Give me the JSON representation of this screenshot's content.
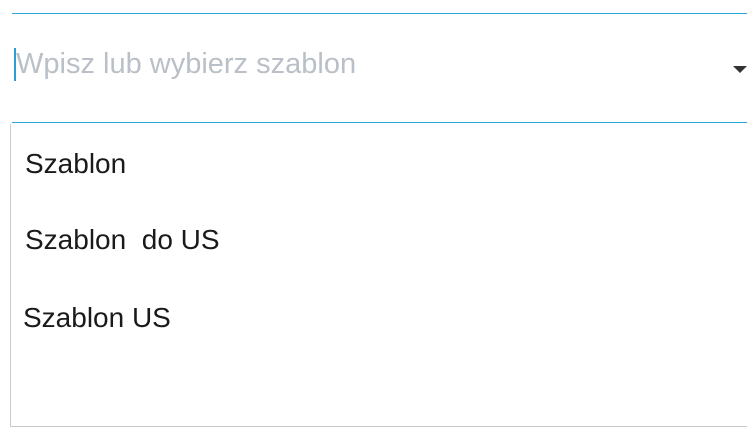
{
  "combo": {
    "placeholder": "Wpisz lub wybierz szablon",
    "value": "",
    "arrow_icon": "caret-down-icon"
  },
  "menu": {
    "items": [
      {
        "label": "Szablon"
      },
      {
        "label": "Szablon  do US"
      },
      {
        "label": "Szablon US"
      }
    ]
  },
  "colors": {
    "accent": "#29a8d8",
    "placeholder": "#b9c0c7",
    "text": "#1a1a1a",
    "border": "#c6cbd0"
  }
}
